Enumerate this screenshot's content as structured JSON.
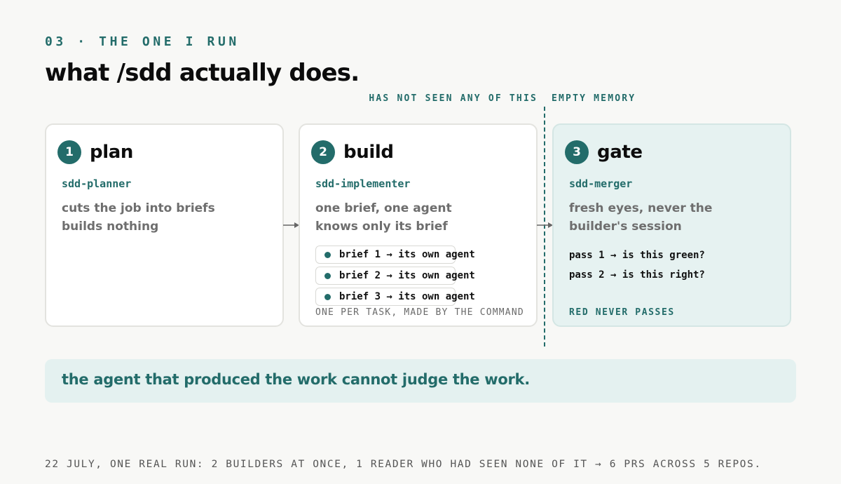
{
  "header": {
    "eyebrow": "03 · THE ONE I RUN",
    "title": "what /sdd actually does."
  },
  "annotations": {
    "left": "HAS NOT SEEN ANY OF THIS",
    "right": "EMPTY MEMORY"
  },
  "steps": [
    {
      "number": "1",
      "title": "plan",
      "agent": "sdd-planner",
      "desc_line1": "cuts the job into briefs",
      "desc_line2": "builds nothing"
    },
    {
      "number": "2",
      "title": "build",
      "agent": "sdd-implementer",
      "desc_line1": "one brief, one agent",
      "desc_line2": "knows only its brief",
      "briefs": [
        "brief 1 → its own agent",
        "brief 2 → its own agent",
        "brief 3 → its own agent"
      ],
      "caption": "ONE PER TASK, MADE BY THE COMMAND"
    },
    {
      "number": "3",
      "title": "gate",
      "agent": "sdd-merger",
      "desc_line1": "fresh eyes, never the",
      "desc_line2": "builder's session",
      "passes": [
        "pass 1 → is this green?",
        "pass 2 → is this right?"
      ],
      "footer": "RED NEVER PASSES"
    }
  ],
  "callout": "the agent that produced the work cannot judge the work.",
  "footer": "22 JULY, ONE REAL RUN: 2 BUILDERS AT ONCE, 1 READER WHO HAD SEEN NONE OF IT → 6 PRS ACROSS 5 REPOS.",
  "colors": {
    "accent": "#236c6a",
    "background": "#f8f8f6",
    "gate_fill": "#e6f2f1",
    "callout_fill": "#e4f1f0"
  }
}
